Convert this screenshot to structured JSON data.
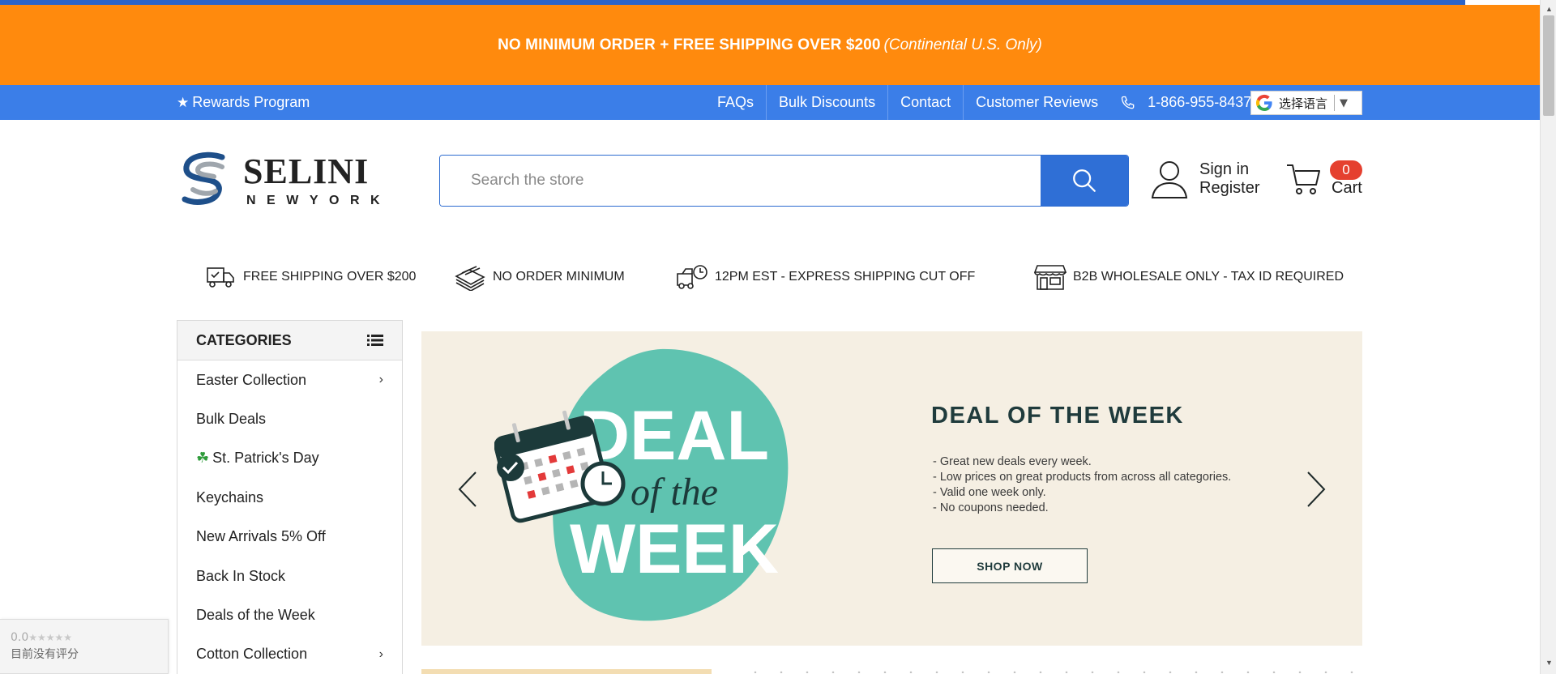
{
  "promo": {
    "bold_text": "NO MINIMUM ORDER + FREE SHIPPING OVER $200",
    "italic_text": "(Continental U.S. Only)"
  },
  "utility": {
    "rewards_star": "★",
    "rewards": "Rewards Program",
    "links": [
      "FAQs",
      "Bulk Discounts",
      "Contact",
      "Customer Reviews"
    ],
    "phone": "1-866-955-8437",
    "language": "选择语言",
    "language_arrow": "▼"
  },
  "logo": {
    "name": "SELINI",
    "sub": "NEWYORK"
  },
  "search": {
    "placeholder": "Search the store"
  },
  "account": {
    "sign_in": "Sign in",
    "register": "Register"
  },
  "cart": {
    "count": "0",
    "label": "Cart"
  },
  "features": [
    {
      "icon": "truck-icon",
      "text": "FREE SHIPPING OVER $200"
    },
    {
      "icon": "cash-stack-icon",
      "text": "NO ORDER MINIMUM"
    },
    {
      "icon": "truck-clock-icon",
      "text": "12PM EST - EXPRESS SHIPPING CUT OFF"
    },
    {
      "icon": "storefront-icon",
      "text": "B2B WHOLESALE ONLY - TAX ID REQUIRED"
    }
  ],
  "categories": {
    "title": "CATEGORIES",
    "items": [
      {
        "label": "Easter Collection",
        "has_children": true
      },
      {
        "label": "Bulk Deals",
        "has_children": false
      },
      {
        "label": "St. Patrick's Day",
        "has_children": false,
        "emoji": "☘"
      },
      {
        "label": "Keychains",
        "has_children": false
      },
      {
        "label": "New Arrivals 5% Off",
        "has_children": false
      },
      {
        "label": "Back In Stock",
        "has_children": false
      },
      {
        "label": "Deals of the Week",
        "has_children": false
      },
      {
        "label": "Cotton Collection",
        "has_children": true
      }
    ]
  },
  "hero": {
    "badge_line1": "DEAL",
    "badge_line2": "of the",
    "badge_line3": "WEEK",
    "title": "DEAL OF THE WEEK",
    "points": [
      "- Great new deals every week.",
      "- Low prices on great products from across all categories.",
      "- Valid one week only.",
      "- No coupons needed."
    ],
    "button": "SHOP NOW"
  },
  "review_badge": {
    "score": "0.0",
    "stars": "★★★★★",
    "text": "目前没有评分"
  },
  "colors": {
    "promo_bg": "#ff8a0d",
    "utility_bg": "#3b7ee8",
    "accent_blue": "#2f6fd6",
    "cart_badge": "#e5402f",
    "badge_teal": "#5fc3b0"
  }
}
